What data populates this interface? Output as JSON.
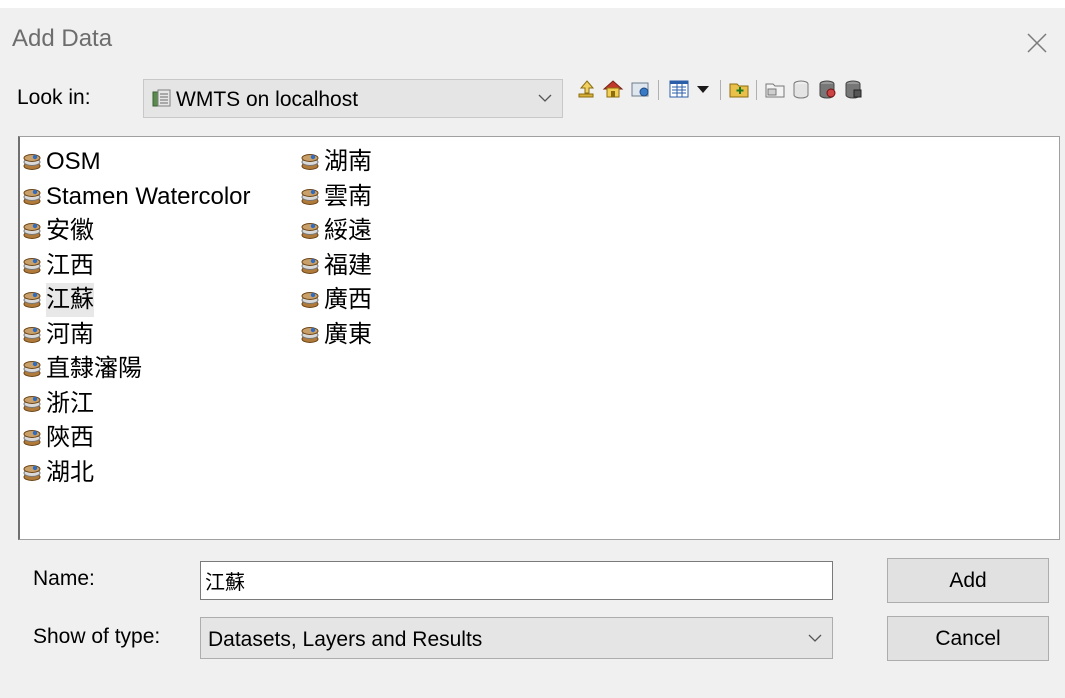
{
  "dialog": {
    "title": "Add Data"
  },
  "look_in": {
    "label": "Look in:",
    "value": "WMTS on localhost",
    "icon": "wmts-connection-icon"
  },
  "toolbar": {
    "icons": [
      "up-one-level-icon",
      "home-icon",
      "connect-to-folder-icon",
      "list-view-icon",
      "view-options-dropdown-icon",
      "new-folder-icon",
      "new-file-geodatabase-icon",
      "new-personal-geodatabase-icon",
      "new-shapefile-icon",
      "new-layer-icon"
    ]
  },
  "file_list": {
    "columns": [
      [
        "OSM",
        "Stamen Watercolor",
        "安徽",
        "江西",
        "江蘇",
        "河南",
        "直隸瀋陽",
        "浙江",
        "陝西",
        "湖北"
      ],
      [
        "湖南",
        "雲南",
        "綏遠",
        "福建",
        "廣西",
        "廣東"
      ]
    ],
    "selected": "江蘇",
    "item_icon": "wmts-layer-icon"
  },
  "name_field": {
    "label": "Name:",
    "value": "江蘇"
  },
  "type_field": {
    "label": "Show of type:",
    "value": "Datasets, Layers and Results"
  },
  "buttons": {
    "add": "Add",
    "cancel": "Cancel"
  },
  "colors": {
    "window_bg": "#f0f0f0",
    "list_bg": "#ffffff",
    "title_text": "#6d6d6d",
    "button_bg": "#e1e1e1"
  }
}
